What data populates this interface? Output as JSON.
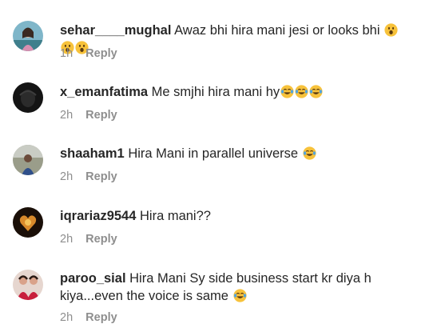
{
  "comments": [
    {
      "username": "sehar____mughal",
      "text": "Awaz bhi hira mani jesi or looks bhi",
      "emoji": [
        "face-with-open-mouth-icon",
        "face-with-open-mouth-icon",
        "face-with-open-mouth-icon"
      ],
      "time": "1h",
      "reply_label": "Reply"
    },
    {
      "username": "x_emanfatima",
      "text": "Me smjhi hira mani hy",
      "emoji": [
        "tears-of-joy-icon",
        "tears-of-joy-icon",
        "tears-of-joy-icon"
      ],
      "time": "2h",
      "reply_label": "Reply"
    },
    {
      "username": "shaaham1",
      "text": "Hira Mani in parallel universe",
      "emoji": [
        "tears-of-joy-icon"
      ],
      "time": "2h",
      "reply_label": "Reply"
    },
    {
      "username": "iqrariaz9544",
      "text": "Hira mani??",
      "emoji": [],
      "time": "2h",
      "reply_label": "Reply"
    },
    {
      "username": "paroo_sial",
      "text": "Hira Mani Sy side business start kr diya h kiya...even the voice is same",
      "emoji": [
        "tears-of-joy-icon"
      ],
      "time": "2h",
      "reply_label": "Reply"
    }
  ],
  "colors": {
    "text": "#262626",
    "secondary": "#8e8e8e",
    "emoji_face": "#f7c23b"
  }
}
